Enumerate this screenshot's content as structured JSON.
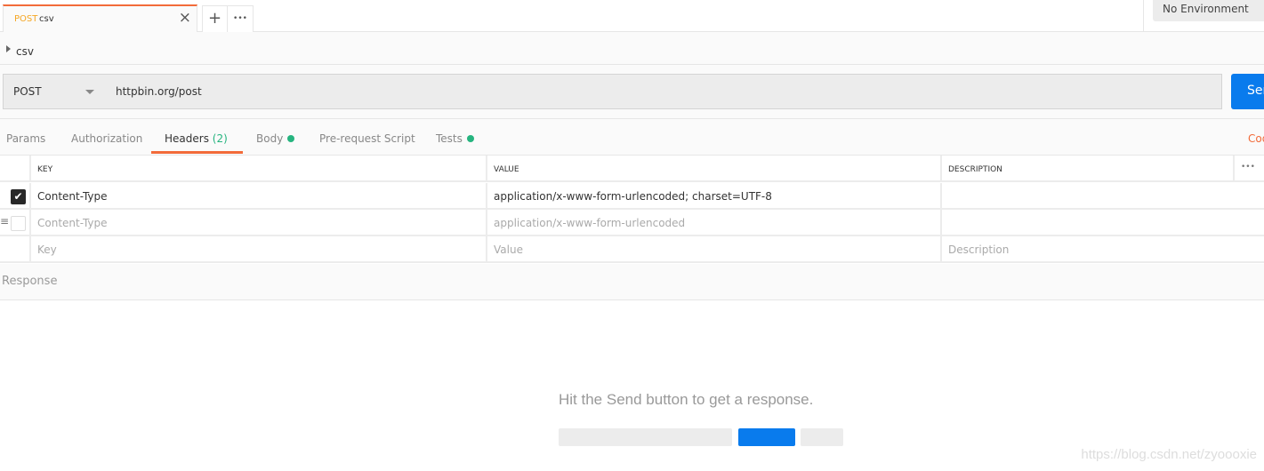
{
  "tabbar": {
    "tab": {
      "method": "POST",
      "name": "csv"
    },
    "new_tab": "+",
    "more": "•••",
    "environment": "No Environment"
  },
  "breadcrumb": {
    "name": "csv"
  },
  "request": {
    "method": "POST",
    "url": "httpbin.org/post",
    "send_label": "Send"
  },
  "req_tabs": {
    "params": "Params",
    "authorization": "Authorization",
    "headers": "Headers",
    "headers_count": "(2)",
    "body": "Body",
    "prerequest": "Pre-request Script",
    "tests": "Tests",
    "code": "Code",
    "active": "Headers",
    "dot_color": "#26b47f"
  },
  "headers_table": {
    "columns": {
      "key": "KEY",
      "value": "VALUE",
      "description": "DESCRIPTION",
      "more": "•••"
    },
    "rows": [
      {
        "checked": true,
        "key": "Content-Type",
        "value": "application/x-www-form-urlencoded; charset=UTF-8",
        "description": ""
      },
      {
        "checked": false,
        "key": "Content-Type",
        "value": "application/x-www-form-urlencoded",
        "description": ""
      }
    ],
    "new_row": {
      "key_placeholder": "Key",
      "value_placeholder": "Value",
      "description_placeholder": "Description"
    }
  },
  "response": {
    "label": "Response",
    "empty_message": "Hit the Send button to get a response."
  },
  "watermark": "https://blog.csdn.net/zyoooxie",
  "colors": {
    "accent": "#f26b3a",
    "send": "#097bed",
    "method_tab": "#f5a623"
  }
}
